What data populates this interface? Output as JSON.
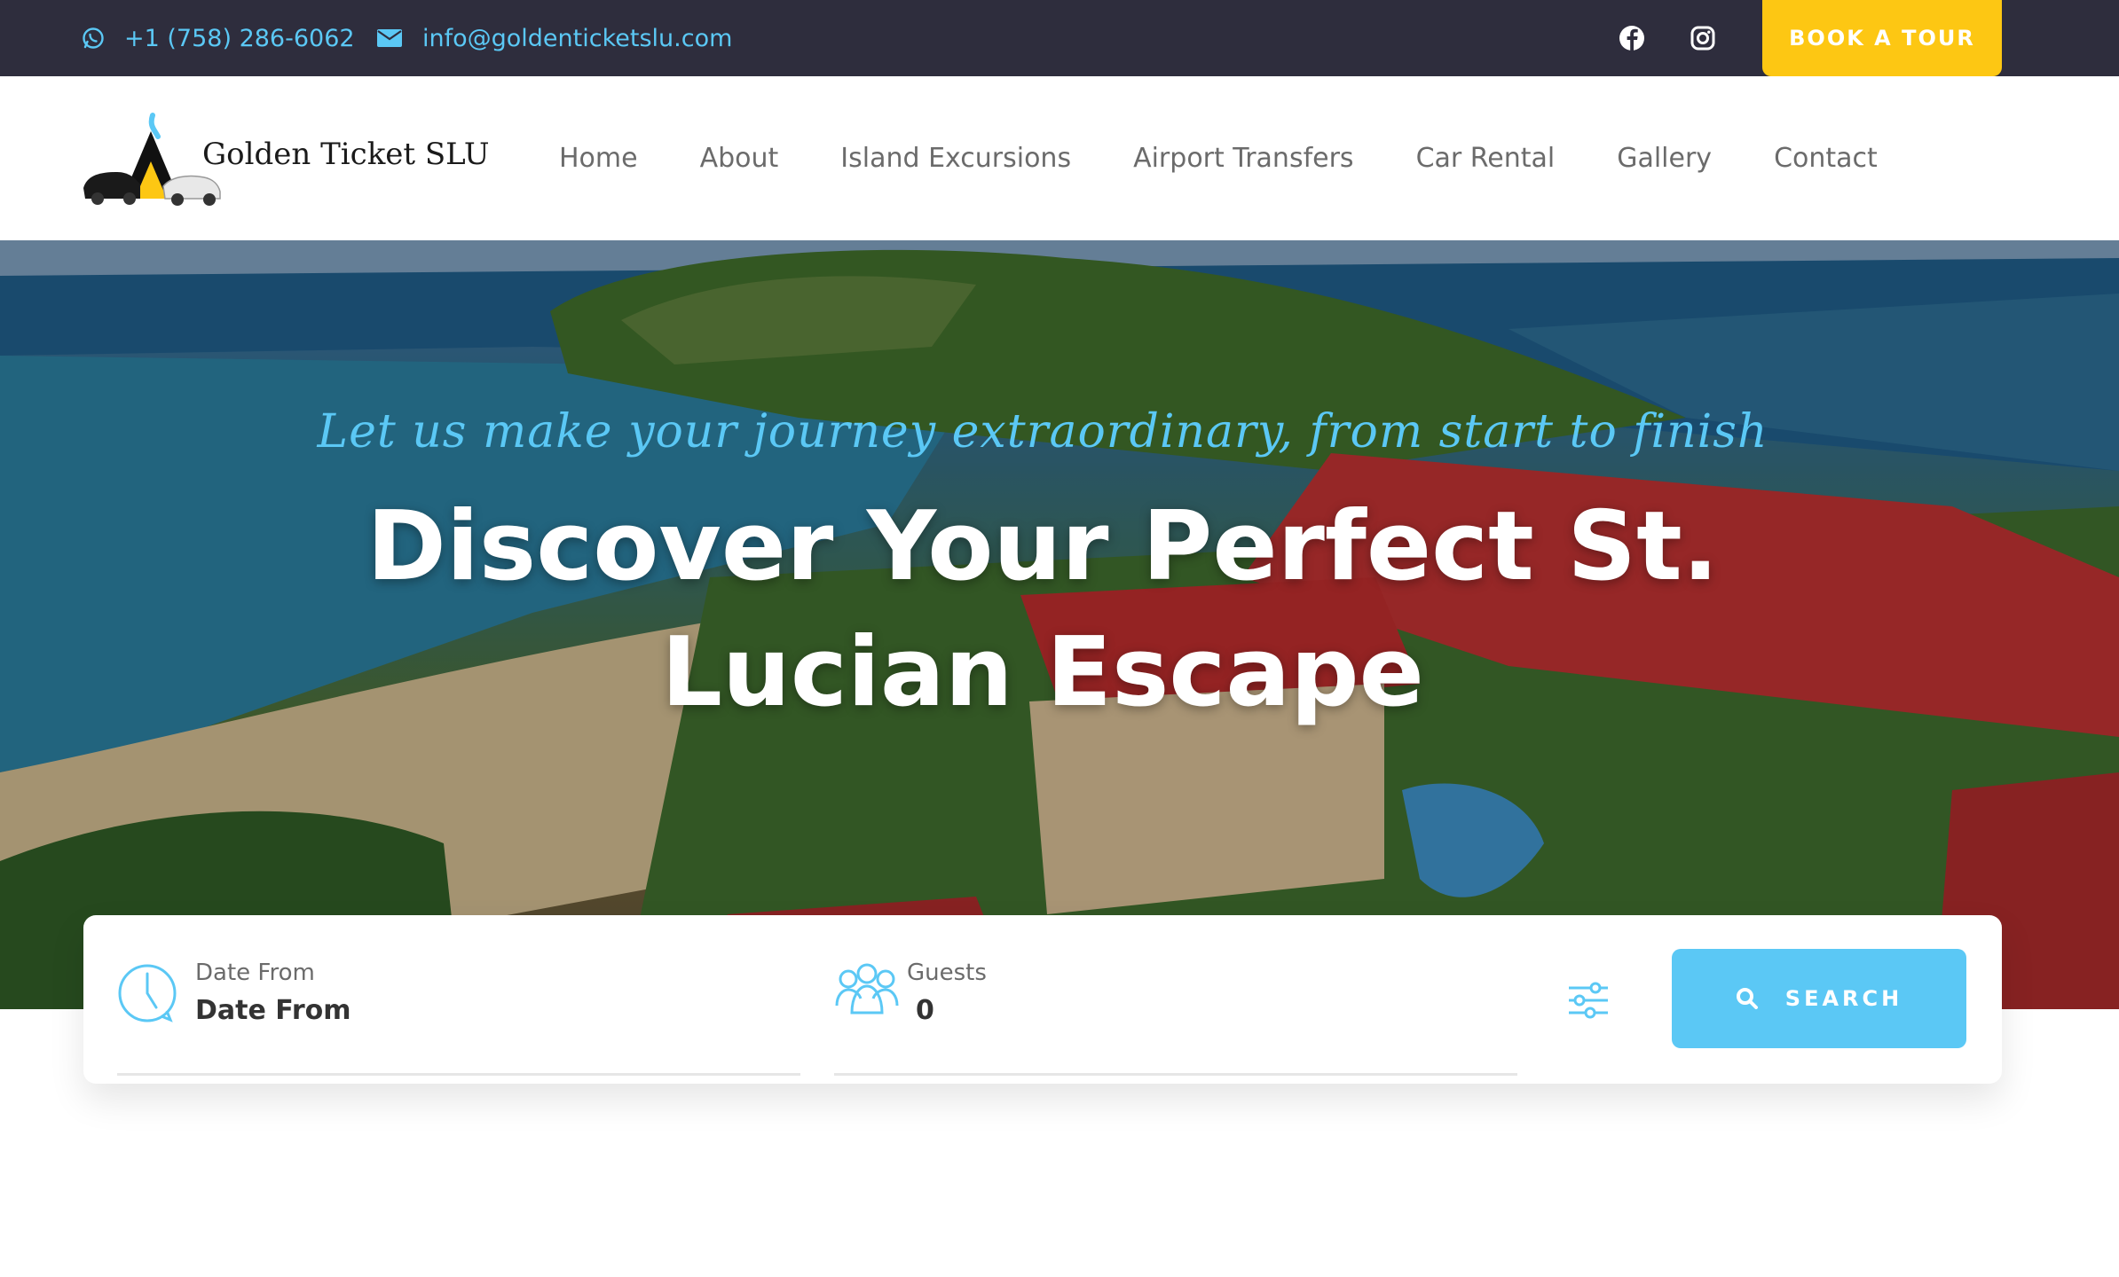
{
  "topbar": {
    "phone": "+1 (758) 286-6062",
    "email": "info@goldenticketslu.com",
    "book_button": "BOOK A TOUR",
    "social": [
      "facebook-icon",
      "instagram-icon"
    ]
  },
  "header": {
    "logo_text": "Golden T⁠icket SLU",
    "nav": [
      "Home",
      "About",
      "Island Excursions",
      "Airport Transfers",
      "Car Rental",
      "Gallery",
      "Contact"
    ]
  },
  "hero": {
    "tagline": "Let us make your journey extraordinary, from start to finish",
    "headline_line1": "Discover Your Perfect St.",
    "headline_line2": "Lucian Escape"
  },
  "search": {
    "date_label": "Date From",
    "date_value": "Date From",
    "guests_label": "Guests",
    "guests_value": "0",
    "button": "SEARCH"
  },
  "colors": {
    "topbar_bg": "#2e2d3d",
    "accent_blue": "#5bc8f5",
    "accent_yellow": "#fdc713",
    "nav_text": "#6b6b6b"
  }
}
